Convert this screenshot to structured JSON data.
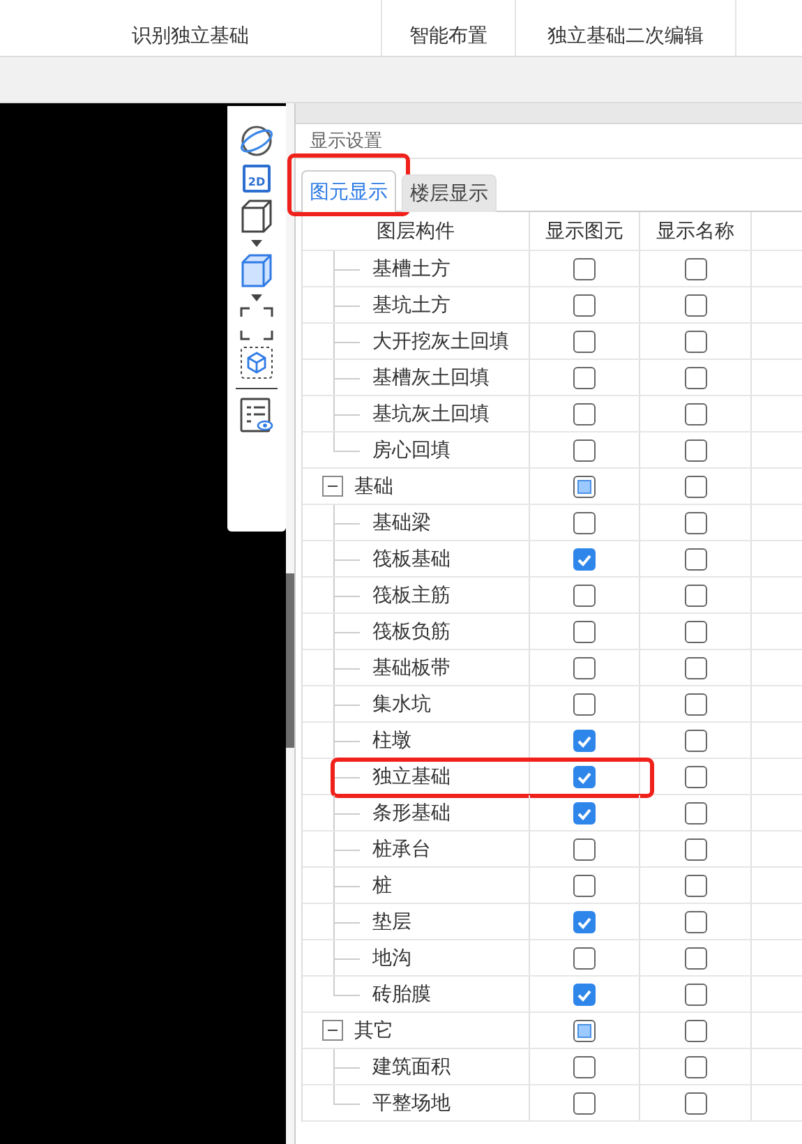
{
  "ribbon": {
    "groups": [
      {
        "label": "识别独立基础"
      },
      {
        "label": "智能布置"
      },
      {
        "label": "独立基础二次编辑"
      }
    ]
  },
  "toolbar": {
    "view_2d_label": "2D"
  },
  "panel": {
    "title": "显示设置",
    "tabs": [
      {
        "label": "图元显示",
        "selected": true,
        "highlighted": true
      },
      {
        "label": "楼层显示",
        "selected": false,
        "highlighted": false
      }
    ],
    "columns": [
      "图层构件",
      "显示图元",
      "显示名称"
    ],
    "tree": [
      {
        "kind": "continued",
        "children": [
          {
            "label": "基槽土方",
            "show": false,
            "name": false,
            "highlighted": false
          },
          {
            "label": "基坑土方",
            "show": false,
            "name": false,
            "highlighted": false
          },
          {
            "label": "大开挖灰土回填",
            "show": false,
            "name": false,
            "highlighted": false
          },
          {
            "label": "基槽灰土回填",
            "show": false,
            "name": false,
            "highlighted": false
          },
          {
            "label": "基坑灰土回填",
            "show": false,
            "name": false,
            "highlighted": false
          },
          {
            "label": "房心回填",
            "show": false,
            "name": false,
            "highlighted": false
          }
        ]
      },
      {
        "kind": "group",
        "label": "基础",
        "expanded": true,
        "show_partial": true,
        "name": false,
        "children": [
          {
            "label": "基础梁",
            "show": false,
            "name": false,
            "highlighted": false
          },
          {
            "label": "筏板基础",
            "show": true,
            "name": false,
            "highlighted": false
          },
          {
            "label": "筏板主筋",
            "show": false,
            "name": false,
            "highlighted": false
          },
          {
            "label": "筏板负筋",
            "show": false,
            "name": false,
            "highlighted": false
          },
          {
            "label": "基础板带",
            "show": false,
            "name": false,
            "highlighted": false
          },
          {
            "label": "集水坑",
            "show": false,
            "name": false,
            "highlighted": false
          },
          {
            "label": "柱墩",
            "show": true,
            "name": false,
            "highlighted": false
          },
          {
            "label": "独立基础",
            "show": true,
            "name": false,
            "highlighted": true
          },
          {
            "label": "条形基础",
            "show": true,
            "name": false,
            "highlighted": false
          },
          {
            "label": "桩承台",
            "show": false,
            "name": false,
            "highlighted": false
          },
          {
            "label": "桩",
            "show": false,
            "name": false,
            "highlighted": false
          },
          {
            "label": "垫层",
            "show": true,
            "name": false,
            "highlighted": false
          },
          {
            "label": "地沟",
            "show": false,
            "name": false,
            "highlighted": false
          },
          {
            "label": "砖胎膜",
            "show": true,
            "name": false,
            "highlighted": false
          }
        ]
      },
      {
        "kind": "group",
        "label": "其它",
        "expanded": true,
        "show_partial": true,
        "name": false,
        "children": [
          {
            "label": "建筑面积",
            "show": false,
            "name": false,
            "highlighted": false
          },
          {
            "label": "平整场地",
            "show": false,
            "name": false,
            "highlighted": false
          }
        ]
      }
    ]
  }
}
